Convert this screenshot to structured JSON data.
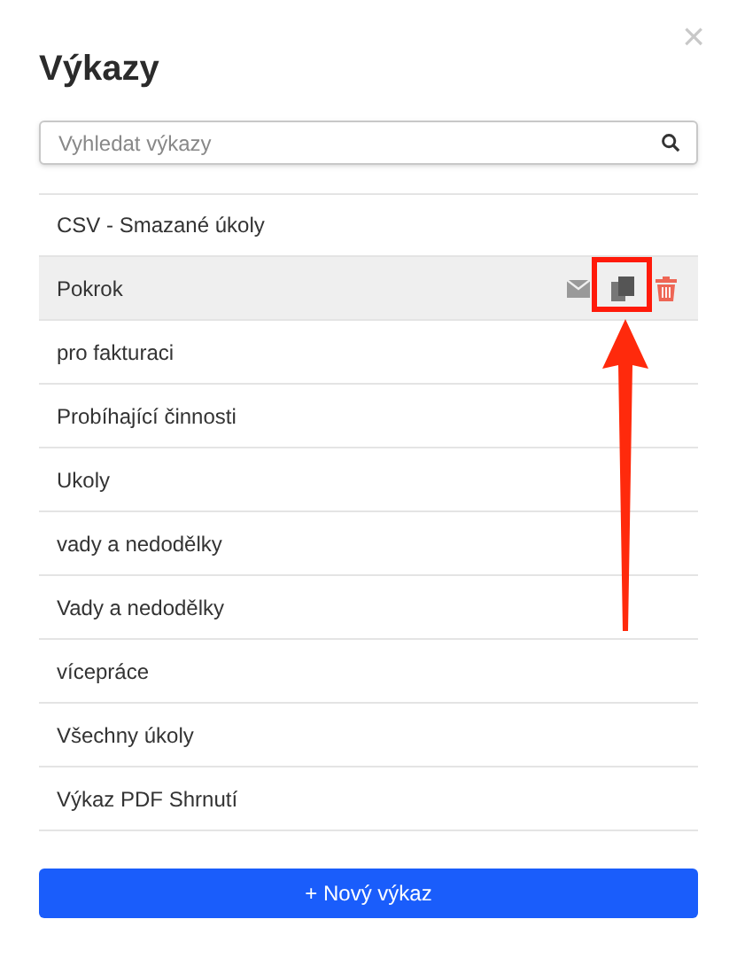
{
  "dialog": {
    "title": "Výkazy",
    "close_label": "×"
  },
  "search": {
    "placeholder": "Vyhledat výkazy"
  },
  "reports": [
    {
      "name": "CSV - Smazané úkoly",
      "selected": false
    },
    {
      "name": "Pokrok",
      "selected": true
    },
    {
      "name": "pro fakturaci",
      "selected": false
    },
    {
      "name": "Probíhající činnosti",
      "selected": false
    },
    {
      "name": "Ukoly",
      "selected": false
    },
    {
      "name": "vady a nedodělky",
      "selected": false
    },
    {
      "name": "Vady a nedodělky",
      "selected": false
    },
    {
      "name": "vícepráce",
      "selected": false
    },
    {
      "name": "Všechny úkoly",
      "selected": false
    },
    {
      "name": "Výkaz PDF Shrnutí",
      "selected": false
    }
  ],
  "new_button": "+ Nový výkaz"
}
